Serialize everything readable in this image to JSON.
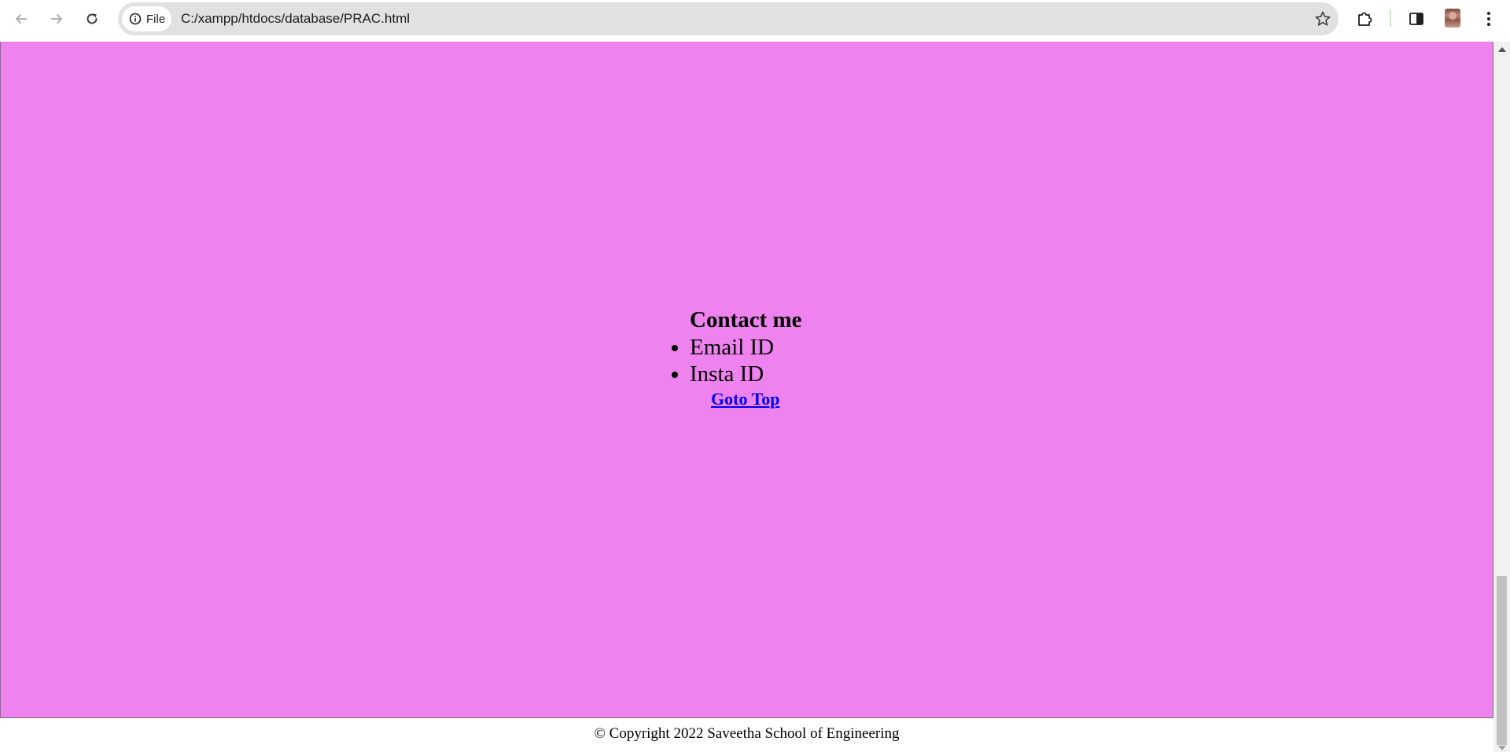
{
  "browser": {
    "url": "C:/xampp/htdocs/database/PRAC.html",
    "site_chip_label": "File",
    "icons": {
      "back": "arrow-left",
      "forward": "arrow-right",
      "reload": "reload",
      "site_info": "info-circle",
      "bookmark": "star-outline",
      "extensions": "puzzle",
      "side_panel": "side-panel",
      "profile": "avatar",
      "menu": "three-dots-vertical"
    }
  },
  "page": {
    "background_color": "#ee82ee",
    "contact": {
      "title": "Contact me",
      "items": [
        "Email ID",
        "Insta ID"
      ],
      "goto_top": "Goto Top"
    },
    "footer": "© Copyright 2022 Saveetha School of Engineering"
  }
}
